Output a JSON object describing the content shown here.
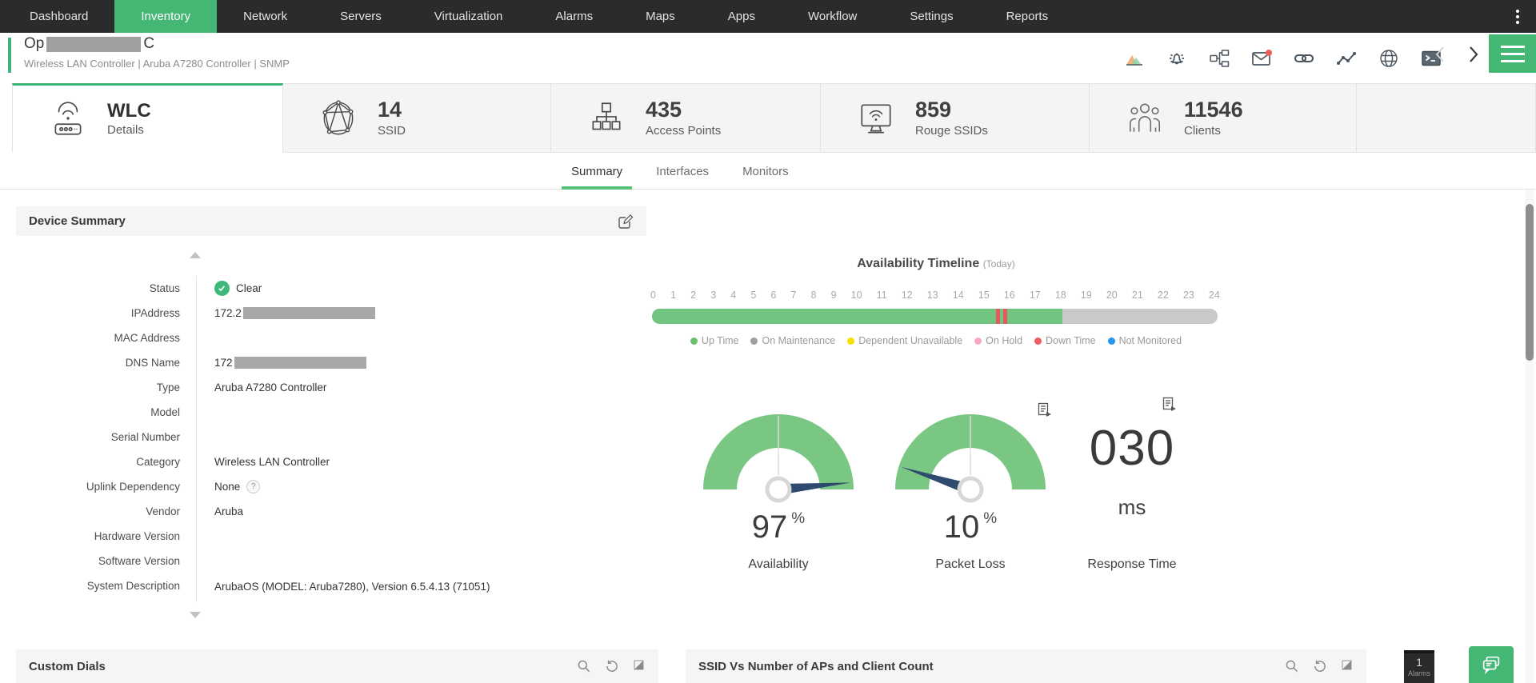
{
  "nav": {
    "items": [
      "Dashboard",
      "Inventory",
      "Network",
      "Servers",
      "Virtualization",
      "Alarms",
      "Maps",
      "Apps",
      "Workflow",
      "Settings",
      "Reports"
    ],
    "active_item": "Inventory"
  },
  "device_header": {
    "name_prefix": "Op",
    "name_suffix": "C",
    "name_redacted": true,
    "meta": "Wireless LAN Controller | Aruba A7280 Controller | SNMP",
    "toolbar_icons": [
      "performance-chart-icon",
      "alarm-bell-icon",
      "workflow-icon",
      "mail-icon",
      "link-icon",
      "traffic-line-icon",
      "globe-icon",
      "terminal-icon",
      "chevron-left-icon",
      "chevron-right-icon",
      "hamburger-menu-icon"
    ],
    "mail_badge_color": "#f05c5c"
  },
  "summary_cards": {
    "wlc": {
      "title": "WLC",
      "subtitle": "Details"
    },
    "stats": [
      {
        "value": "14",
        "label": "SSID"
      },
      {
        "value": "435",
        "label": "Access Points"
      },
      {
        "value": "859",
        "label": "Rouge SSIDs"
      },
      {
        "value": "11546",
        "label": "Clients"
      }
    ]
  },
  "tabs": [
    "Summary",
    "Interfaces",
    "Monitors"
  ],
  "device_summary": {
    "title": "Device Summary",
    "fields": [
      {
        "label": "Status",
        "value": "Clear",
        "status_color": "#3cb878"
      },
      {
        "label": "IPAddress",
        "value": "172.2",
        "redacted": true
      },
      {
        "label": "MAC Address",
        "value": ""
      },
      {
        "label": "DNS Name",
        "value": "172",
        "redacted": true
      },
      {
        "label": "Type",
        "value": "Aruba A7280 Controller"
      },
      {
        "label": "Model",
        "value": ""
      },
      {
        "label": "Serial Number",
        "value": ""
      },
      {
        "label": "Category",
        "value": "Wireless LAN Controller"
      },
      {
        "label": "Uplink Dependency",
        "value": "None",
        "help": "?"
      },
      {
        "label": "Vendor",
        "value": "Aruba"
      },
      {
        "label": "Hardware Version",
        "value": ""
      },
      {
        "label": "Software Version",
        "value": ""
      },
      {
        "label": "System Description",
        "value": "ArubaOS (MODEL: Aruba7280), Version 6.5.4.13 (71051)"
      }
    ]
  },
  "availability_timeline": {
    "title": "Availability Timeline",
    "period": "(Today)",
    "hours": [
      "0",
      "1",
      "2",
      "3",
      "4",
      "5",
      "6",
      "7",
      "8",
      "9",
      "10",
      "11",
      "12",
      "13",
      "14",
      "15",
      "16",
      "17",
      "18",
      "19",
      "20",
      "21",
      "22",
      "23",
      "24"
    ],
    "segments": [
      {
        "status": "up",
        "from_hour": 0,
        "to_hour": 14.6
      },
      {
        "status": "down",
        "from_hour": 14.6,
        "to_hour": 14.8
      },
      {
        "status": "up",
        "from_hour": 14.8,
        "to_hour": 14.9
      },
      {
        "status": "down",
        "from_hour": 14.9,
        "to_hour": 15.1
      },
      {
        "status": "up",
        "from_hour": 15.1,
        "to_hour": 17.4
      },
      {
        "status": "remaining",
        "from_hour": 17.4,
        "to_hour": 24
      }
    ],
    "colors": {
      "up": "#72c581",
      "down": "#e8595f",
      "remaining": "#c9c9c9"
    },
    "legend": [
      {
        "label": "Up Time",
        "color": "#6cbf6c"
      },
      {
        "label": "On Maintenance",
        "color": "#9e9e9e"
      },
      {
        "label": "Dependent Unavailable",
        "color": "#f5e000"
      },
      {
        "label": "On Hold",
        "color": "#f8a9c0"
      },
      {
        "label": "Down Time",
        "color": "#ef5c63"
      },
      {
        "label": "Not Monitored",
        "color": "#2196f3"
      }
    ]
  },
  "gauges": {
    "availability": {
      "value": "97",
      "unit": "%",
      "label": "Availability",
      "percent": 97
    },
    "packet_loss": {
      "value": "10",
      "unit": "%",
      "label": "Packet Loss",
      "percent": 10
    },
    "response_time": {
      "value": "030",
      "unit": "ms",
      "label": "Response Time"
    },
    "gauge_color": "#79c783",
    "needle_color": "#2e4a6e"
  },
  "bottom_panels": {
    "left": {
      "title": "Custom Dials",
      "icons": [
        "search-icon",
        "refresh-icon",
        "expand-icon"
      ]
    },
    "right": {
      "title": "SSID Vs Number of APs and Client Count",
      "icons": [
        "search-icon",
        "refresh-icon",
        "expand-icon"
      ]
    }
  },
  "alarm_widget": {
    "count": "1",
    "label": "Alarms"
  }
}
